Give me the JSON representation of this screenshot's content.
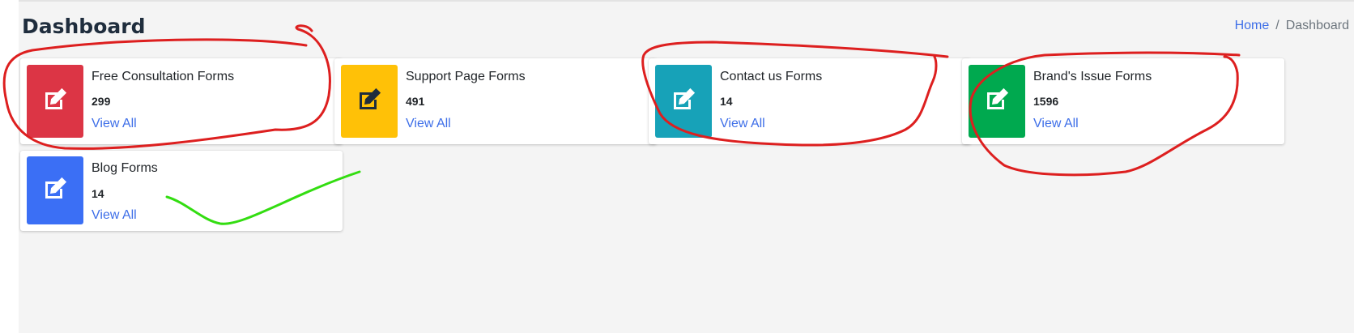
{
  "header": {
    "title": "Dashboard",
    "breadcrumb": {
      "home": "Home",
      "separator": "/",
      "current": "Dashboard"
    }
  },
  "cards": [
    {
      "label": "Free Consultation Forms",
      "count": "299",
      "link": "View All",
      "icon": "edit-icon",
      "color": "#dc3545",
      "icon_color": "#ffffff"
    },
    {
      "label": "Support Page Forms",
      "count": "491",
      "link": "View All",
      "icon": "edit-icon",
      "color": "#ffc107",
      "icon_color": "#1f2d3d"
    },
    {
      "label": "Contact us Forms",
      "count": "14",
      "link": "View All",
      "icon": "edit-icon",
      "color": "#17a2b8",
      "icon_color": "#ffffff"
    },
    {
      "label": "Brand's Issue Forms",
      "count": "1596",
      "link": "View All",
      "icon": "edit-icon",
      "color": "#00a94f",
      "icon_color": "#ffffff"
    },
    {
      "label": "Blog Forms",
      "count": "14",
      "link": "View All",
      "icon": "edit-icon",
      "color": "#3b6ff5",
      "icon_color": "#ffffff"
    }
  ],
  "annotations": {
    "circle_color": "#dd1f1f",
    "check_color": "#33dd11"
  }
}
